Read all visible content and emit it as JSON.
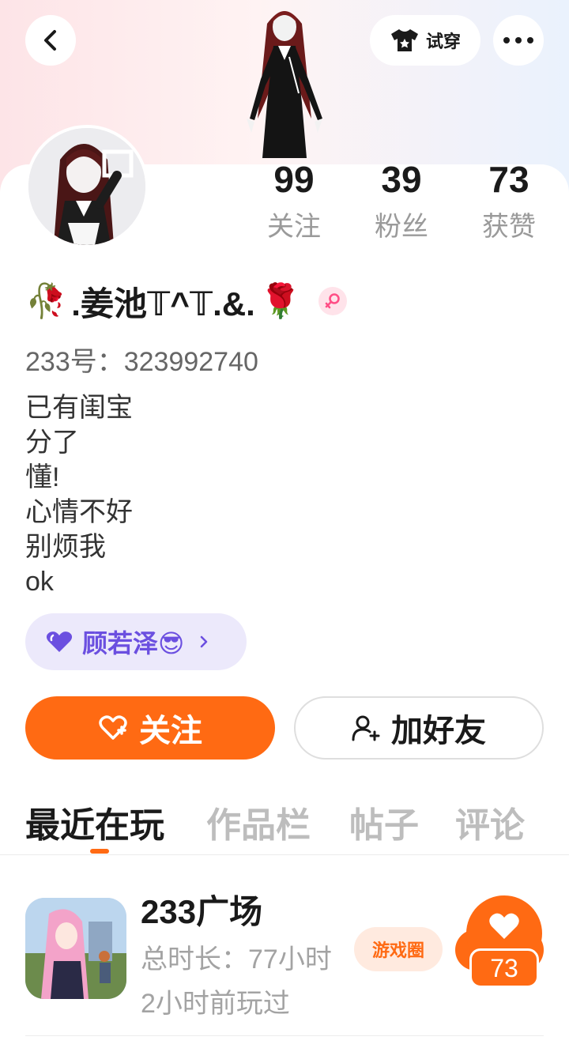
{
  "header": {
    "try_on_label": "试穿",
    "back_icon": "chevron-left-icon",
    "more_icon": "more-dots-icon",
    "try_on_icon": "shirt-icon"
  },
  "profile": {
    "stats": [
      {
        "value": "99",
        "label": "关注"
      },
      {
        "value": "39",
        "label": "粉丝"
      },
      {
        "value": "73",
        "label": "获赞"
      }
    ],
    "name_prefix": "🥀",
    "name": ".姜池𝕋^𝕋.&.",
    "name_suffix": "🌹",
    "gender_icon": "female-icon",
    "user_id": "233号：323992740",
    "bio_lines": [
      "已有闺宝",
      "分了",
      "懂!",
      "心情不好",
      "别烦我",
      "ok"
    ],
    "cp": {
      "icon": "heart-icon",
      "name": "顾若泽😎"
    }
  },
  "actions": {
    "follow_label": "关注",
    "add_friend_label": "加好友"
  },
  "tabs": [
    "最近在玩",
    "作品栏",
    "帖子",
    "评论"
  ],
  "game": {
    "title": "233广场",
    "duration": "总时长：77小时",
    "last_played": "2小时前玩过",
    "circle_tag": "游戏圈",
    "likes": "73"
  },
  "colors": {
    "accent": "#ff6a13",
    "cp_purple": "#6b4fe0",
    "cp_bg": "#ece9fb"
  }
}
